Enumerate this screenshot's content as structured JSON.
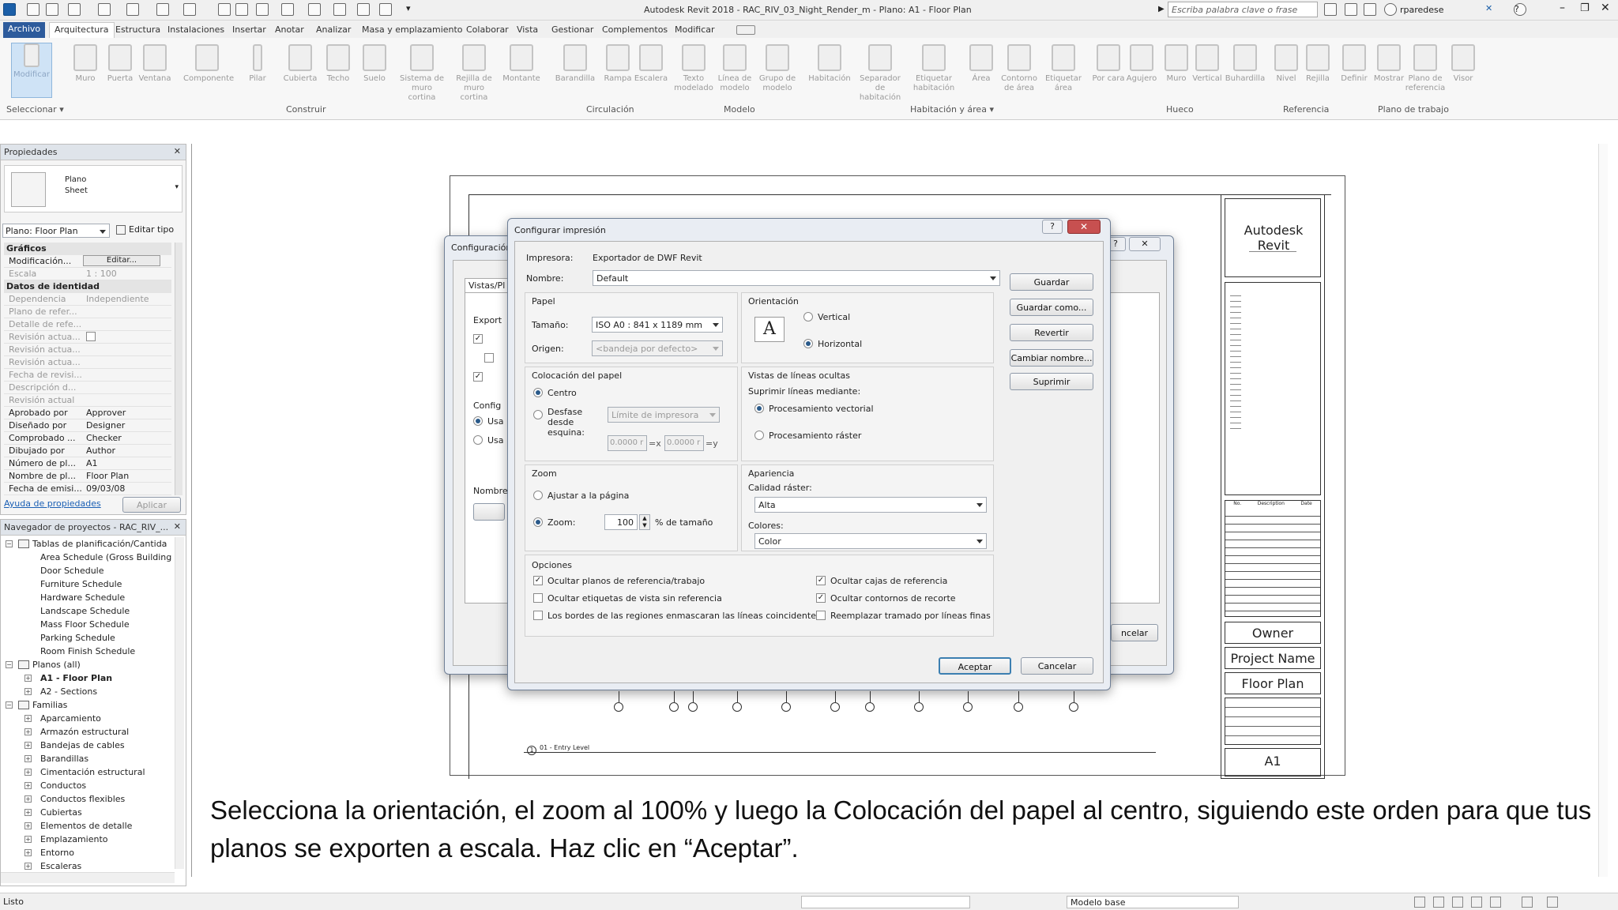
{
  "titlebar": {
    "title": "Autodesk Revit 2018 -     RAC_RIV_03_Night_Render_m - Plano: A1 - Floor Plan",
    "search_placeholder": "Escriba palabra clave o frase",
    "user": "rparedese"
  },
  "ribbon": {
    "tabs": [
      "Archivo",
      "Arquitectura",
      "Estructura",
      "Instalaciones",
      "Insertar",
      "Anotar",
      "Analizar",
      "Masa y emplazamiento",
      "Colaborar",
      "Vista",
      "Gestionar",
      "Complementos",
      "Modificar"
    ],
    "active_tab": "Arquitectura",
    "buttons": [
      {
        "label": "Modificar",
        "icon": "cursor-icon"
      },
      {
        "label": "Muro",
        "icon": "wall-icon"
      },
      {
        "label": "Puerta",
        "icon": "door-icon"
      },
      {
        "label": "Ventana",
        "icon": "window-icon"
      },
      {
        "label": "Componente",
        "icon": "component-icon"
      },
      {
        "label": "Pilar",
        "icon": "column-icon"
      },
      {
        "label": "Cubierta",
        "icon": "roof-icon"
      },
      {
        "label": "Techo",
        "icon": "ceiling-icon"
      },
      {
        "label": "Suelo",
        "icon": "floor-icon"
      },
      {
        "label": "Sistema de muro cortina",
        "icon": "curtain-system-icon"
      },
      {
        "label": "Rejilla de muro cortina",
        "icon": "curtain-grid-icon"
      },
      {
        "label": "Montante",
        "icon": "mullion-icon"
      },
      {
        "label": "Barandilla",
        "icon": "railing-icon"
      },
      {
        "label": "Rampa",
        "icon": "ramp-icon"
      },
      {
        "label": "Escalera",
        "icon": "stair-icon"
      },
      {
        "label": "Texto modelado",
        "icon": "model-text-icon"
      },
      {
        "label": "Línea de modelo",
        "icon": "model-line-icon"
      },
      {
        "label": "Grupo de modelo",
        "icon": "model-group-icon"
      },
      {
        "label": "Habitación",
        "icon": "room-icon"
      },
      {
        "label": "Separador de habitación",
        "icon": "room-separator-icon"
      },
      {
        "label": "Etiquetar habitación",
        "icon": "tag-room-icon"
      },
      {
        "label": "Área",
        "icon": "area-icon"
      },
      {
        "label": "Contorno de área",
        "icon": "area-boundary-icon"
      },
      {
        "label": "Etiquetar área",
        "icon": "tag-area-icon"
      },
      {
        "label": "Por cara",
        "icon": "by-face-icon"
      },
      {
        "label": "Agujero",
        "icon": "shaft-icon"
      },
      {
        "label": "Muro",
        "icon": "wall-opening-icon"
      },
      {
        "label": "Vertical",
        "icon": "vertical-opening-icon"
      },
      {
        "label": "Buhardilla",
        "icon": "dormer-icon"
      },
      {
        "label": "Nivel",
        "icon": "level-icon"
      },
      {
        "label": "Rejilla",
        "icon": "grid-icon"
      },
      {
        "label": "Definir",
        "icon": "set-icon"
      },
      {
        "label": "Mostrar",
        "icon": "show-icon"
      },
      {
        "label": "Plano de referencia",
        "icon": "ref-plane-icon"
      },
      {
        "label": "Visor",
        "icon": "viewer-icon"
      }
    ],
    "groups": [
      "Seleccionar",
      "Construir",
      "Circulación",
      "Modelo",
      "Habitación y área",
      "Hueco",
      "Referencia",
      "Plano de trabajo"
    ]
  },
  "properties": {
    "header": "Propiedades",
    "type_name": "Plano",
    "type_sub": "Sheet",
    "selector": "Plano: Floor Plan",
    "edit_type": "Editar tipo",
    "section_graphics": "Gráficos",
    "section_identity": "Datos de identidad",
    "rows": [
      {
        "k": "Modificación...",
        "v": "Editar...",
        "dim": false
      },
      {
        "k": "Escala",
        "v": "1 : 100",
        "dim": true
      },
      {
        "k": "Dependencia",
        "v": "Independiente",
        "dim": true
      },
      {
        "k": "Plano de refer...",
        "v": "",
        "dim": true
      },
      {
        "k": "Detalle de refe...",
        "v": "",
        "dim": true
      },
      {
        "k": "Revisión actua...",
        "v": "",
        "dim": true
      },
      {
        "k": "Revisión actua...",
        "v": "",
        "dim": true
      },
      {
        "k": "Revisión actua...",
        "v": "",
        "dim": true
      },
      {
        "k": "Fecha de revisi...",
        "v": "",
        "dim": true
      },
      {
        "k": "Descripción d...",
        "v": "",
        "dim": true
      },
      {
        "k": "Revisión actual",
        "v": "",
        "dim": true
      },
      {
        "k": "Aprobado por",
        "v": "Approver",
        "dim": false
      },
      {
        "k": "Diseñado por",
        "v": "Designer",
        "dim": false
      },
      {
        "k": "Comprobado ...",
        "v": "Checker",
        "dim": false
      },
      {
        "k": "Dibujado por",
        "v": "Author",
        "dim": false
      },
      {
        "k": "Número de pl...",
        "v": "A1",
        "dim": false
      },
      {
        "k": "Nombre de pl...",
        "v": "Floor Plan",
        "dim": false
      },
      {
        "k": "Fecha de emisi...",
        "v": "09/03/08",
        "dim": false
      }
    ],
    "help_link": "Ayuda de propiedades",
    "apply": "Aplicar"
  },
  "browser": {
    "header": "Navegador de proyectos - RAC_RIV_...",
    "nodes": [
      {
        "label": "Tablas de planificación/Cantida",
        "level": 0,
        "exp": "−"
      },
      {
        "label": "Area Schedule (Gross Building",
        "level": 1,
        "exp": ""
      },
      {
        "label": "Door Schedule",
        "level": 1,
        "exp": ""
      },
      {
        "label": "Furniture Schedule",
        "level": 1,
        "exp": ""
      },
      {
        "label": "Hardware Schedule",
        "level": 1,
        "exp": ""
      },
      {
        "label": "Landscape Schedule",
        "level": 1,
        "exp": ""
      },
      {
        "label": "Mass Floor Schedule",
        "level": 1,
        "exp": ""
      },
      {
        "label": "Parking Schedule",
        "level": 1,
        "exp": ""
      },
      {
        "label": "Room Finish Schedule",
        "level": 1,
        "exp": ""
      },
      {
        "label": "Planos (all)",
        "level": 0,
        "exp": "−"
      },
      {
        "label": "A1 - Floor Plan",
        "level": 1,
        "exp": "+",
        "bold": true
      },
      {
        "label": "A2 - Sections",
        "level": 1,
        "exp": "+"
      },
      {
        "label": "Familias",
        "level": 0,
        "exp": "−"
      },
      {
        "label": "Aparcamiento",
        "level": 1,
        "exp": "+"
      },
      {
        "label": "Armazón estructural",
        "level": 1,
        "exp": "+"
      },
      {
        "label": "Bandejas de cables",
        "level": 1,
        "exp": "+"
      },
      {
        "label": "Barandillas",
        "level": 1,
        "exp": "+"
      },
      {
        "label": "Cimentación estructural",
        "level": 1,
        "exp": "+"
      },
      {
        "label": "Conductos",
        "level": 1,
        "exp": "+"
      },
      {
        "label": "Conductos flexibles",
        "level": 1,
        "exp": "+"
      },
      {
        "label": "Cubiertas",
        "level": 1,
        "exp": "+"
      },
      {
        "label": "Elementos de detalle",
        "level": 1,
        "exp": "+"
      },
      {
        "label": "Emplazamiento",
        "level": 1,
        "exp": "+"
      },
      {
        "label": "Entorno",
        "level": 1,
        "exp": "+"
      },
      {
        "label": "Escaleras",
        "level": 1,
        "exp": "+"
      }
    ]
  },
  "sheet": {
    "brand": "Autodesk Revit",
    "owner": "Owner",
    "project_name": "Project Name",
    "sheet_name": "Floor Plan",
    "sheet_number": "A1",
    "view_label": "01 - Entry Level",
    "view_number": "1",
    "revision_cols": [
      "No.",
      "Description",
      "Date"
    ]
  },
  "back_dialog": {
    "title": "Configuración d",
    "tab": "Vistas/Pl",
    "label_export": "Export",
    "label_config": "Config",
    "label_name": "Nombre",
    "opt1": "Usa",
    "opt2": "Usa",
    "cancel_partial": "ncelar"
  },
  "print_dialog": {
    "title": "Configurar impresión",
    "printer_label": "Impresora:",
    "printer_value": "Exportador de DWF Revit",
    "name_label": "Nombre:",
    "name_value": "Default",
    "paper_group": "Papel",
    "size_label": "Tamaño:",
    "size_value": "ISO A0 : 841 x 1189 mm",
    "source_label": "Origen:",
    "source_value": "<bandeja por defecto>",
    "orientation_group": "Orientación",
    "orient_vertical": "Vertical",
    "orient_horizontal": "Horizontal",
    "placement_group": "Colocación del papel",
    "place_center": "Centro",
    "place_offset": "Desfase desde esquina:",
    "offset_select": "Límite de impresora",
    "offset_x": "0.0000 r",
    "offset_x_unit": "=x",
    "offset_y": "0.0000 r",
    "offset_y_unit": "=y",
    "hidden_group": "Vistas de líneas ocultas",
    "hidden_label": "Suprimir líneas mediante:",
    "hidden_vector": "Procesamiento vectorial",
    "hidden_raster": "Procesamiento ráster",
    "zoom_group": "Zoom",
    "zoom_fit": "Ajustar a la página",
    "zoom_label": "Zoom:",
    "zoom_value": "100",
    "zoom_unit": "% de tamaño",
    "appearance_group": "Apariencia",
    "raster_quality_label": "Calidad ráster:",
    "raster_quality_value": "Alta",
    "colors_label": "Colores:",
    "colors_value": "Color",
    "options_group": "Opciones",
    "options": [
      {
        "label": "Ocultar planos de referencia/trabajo",
        "checked": true
      },
      {
        "label": "Ocultar etiquetas de vista sin referencia",
        "checked": false
      },
      {
        "label": "Los bordes de las regiones enmascaran las líneas coincidentes",
        "checked": false
      },
      {
        "label": "Ocultar cajas de referencia",
        "checked": true
      },
      {
        "label": "Ocultar contornos de recorte",
        "checked": true
      },
      {
        "label": "Reemplazar tramado por líneas finas",
        "checked": false
      }
    ],
    "btn_save": "Guardar",
    "btn_save_as": "Guardar como...",
    "btn_revert": "Revertir",
    "btn_rename": "Cambiar nombre...",
    "btn_delete": "Suprimir",
    "btn_ok": "Aceptar",
    "btn_cancel": "Cancelar"
  },
  "caption": "Selecciona la orientación, el zoom al 100% y luego la Colocación del papel al centro, siguiendo este orden para que tus planos se exporten a escala. Haz clic en “Aceptar”.",
  "status": {
    "left": "Listo",
    "workset": "Modelo base"
  }
}
